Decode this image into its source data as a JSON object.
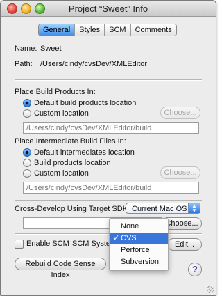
{
  "window": {
    "title": "Project “Sweet” Info"
  },
  "tabs": [
    {
      "label": "General",
      "active": true
    },
    {
      "label": "Styles",
      "active": false
    },
    {
      "label": "SCM",
      "active": false
    },
    {
      "label": "Comments",
      "active": false
    }
  ],
  "info": {
    "name_label": "Name:",
    "name_value": "Sweet",
    "path_label": "Path:",
    "path_value": "/Users/cindy/cvsDev/XMLEditor"
  },
  "build_products": {
    "heading": "Place Build Products In:",
    "option_default": "Default build products location",
    "option_custom": "Custom location",
    "choose_label": "Choose...",
    "path_value": "/Users/cindy/cvsDev/XMLEditor/build"
  },
  "intermediate": {
    "heading": "Place Intermediate Build Files In:",
    "option_default": "Default intermediates location",
    "option_build": "Build products location",
    "option_custom": "Custom location",
    "choose_label": "Choose...",
    "path_value": "/Users/cindy/cvsDev/XMLEditor/build"
  },
  "sdk": {
    "label": "Cross-Develop Using Target SDK:",
    "selected": "Current Mac OS",
    "choose_label": "Choose..."
  },
  "scm": {
    "enable_label": "Enable SCM",
    "system_label": "SCM System",
    "edit_label": "Edit...",
    "menu_items": [
      {
        "label": "None",
        "checked": false
      },
      {
        "label": "CVS",
        "checked": true,
        "check_mark": "✓"
      },
      {
        "label": "Perforce",
        "checked": false
      },
      {
        "label": "Subversion",
        "checked": false
      }
    ]
  },
  "rebuild_label": "Rebuild Code Sense Index",
  "help_label": "?",
  "colors": {
    "accent": "#3876d9",
    "tab_active": "#3d8fe8"
  }
}
